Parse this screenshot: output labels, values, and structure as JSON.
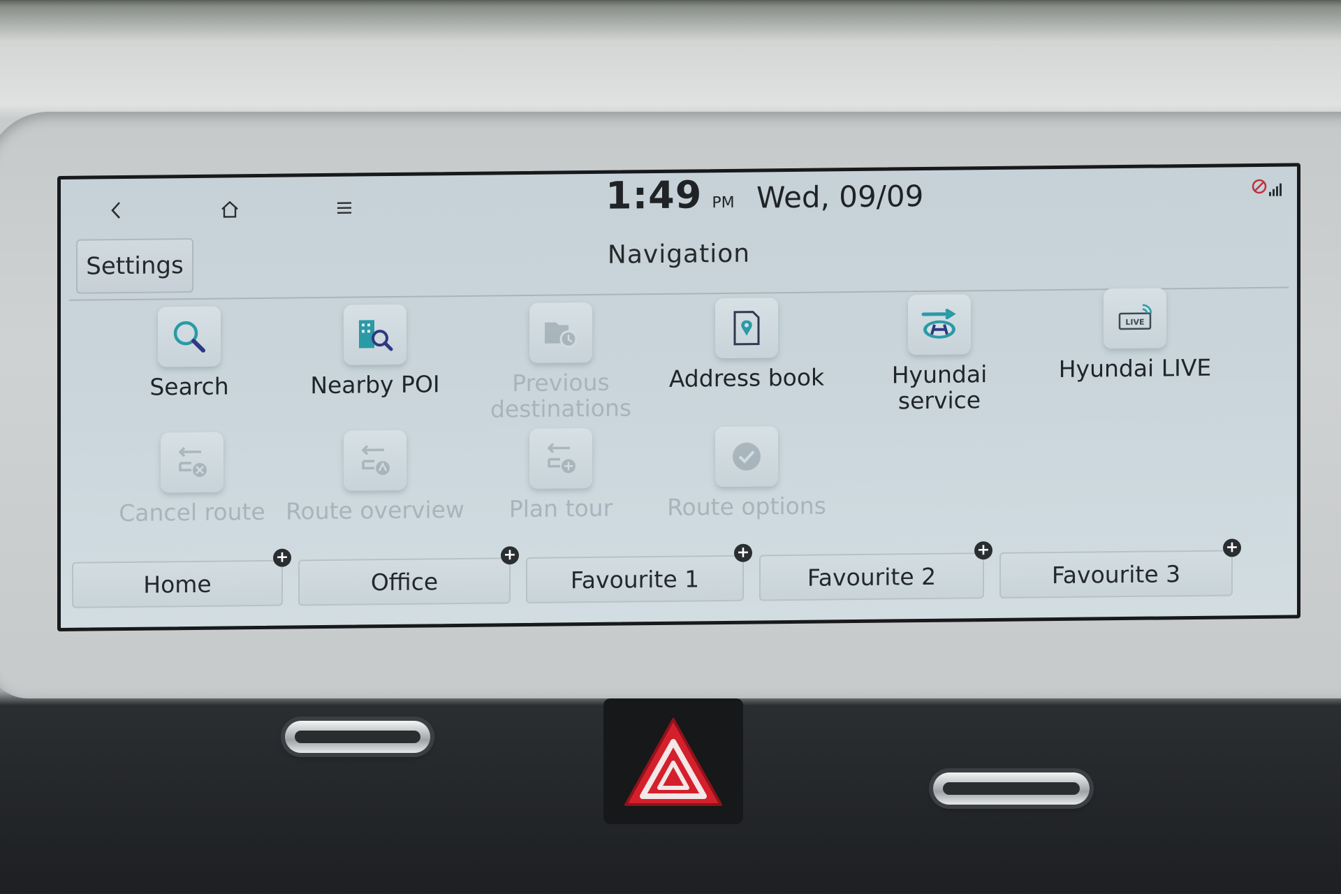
{
  "status": {
    "time": "1:49",
    "ampm": "PM",
    "date": "Wed, 09/09",
    "back_icon": "back-chevron-icon",
    "home_icon": "home-icon",
    "menu_icon": "menu-icon",
    "signal_icon": "signal-icon"
  },
  "header": {
    "settings_label": "Settings",
    "title": "Navigation"
  },
  "menu": {
    "row1": [
      {
        "label": "Search",
        "icon": "search-icon",
        "enabled": true
      },
      {
        "label": "Nearby POI",
        "icon": "nearby-poi-icon",
        "enabled": true
      },
      {
        "label": "Previous destinations",
        "icon": "previous-destinations-icon",
        "enabled": false
      },
      {
        "label": "Address book",
        "icon": "address-book-icon",
        "enabled": true
      },
      {
        "label": "Hyundai service",
        "icon": "hyundai-service-icon",
        "enabled": true
      },
      {
        "label": "Hyundai LIVE",
        "icon": "hyundai-live-icon",
        "enabled": true,
        "badge": "LIVE"
      }
    ],
    "row2": [
      {
        "label": "Cancel route",
        "icon": "cancel-route-icon",
        "enabled": false
      },
      {
        "label": "Route overview",
        "icon": "route-overview-icon",
        "enabled": false
      },
      {
        "label": "Plan tour",
        "icon": "plan-tour-icon",
        "enabled": false
      },
      {
        "label": "Route options",
        "icon": "route-options-icon",
        "enabled": false
      }
    ]
  },
  "favourites": [
    {
      "label": "Home"
    },
    {
      "label": "Office"
    },
    {
      "label": "Favourite 1"
    },
    {
      "label": "Favourite 2"
    },
    {
      "label": "Favourite 3"
    }
  ],
  "colors": {
    "accent": "#2a9aa6",
    "icon_dark": "#3a4a52",
    "disabled_text": "#a7b4bb",
    "hazard_red": "#d4202c"
  }
}
